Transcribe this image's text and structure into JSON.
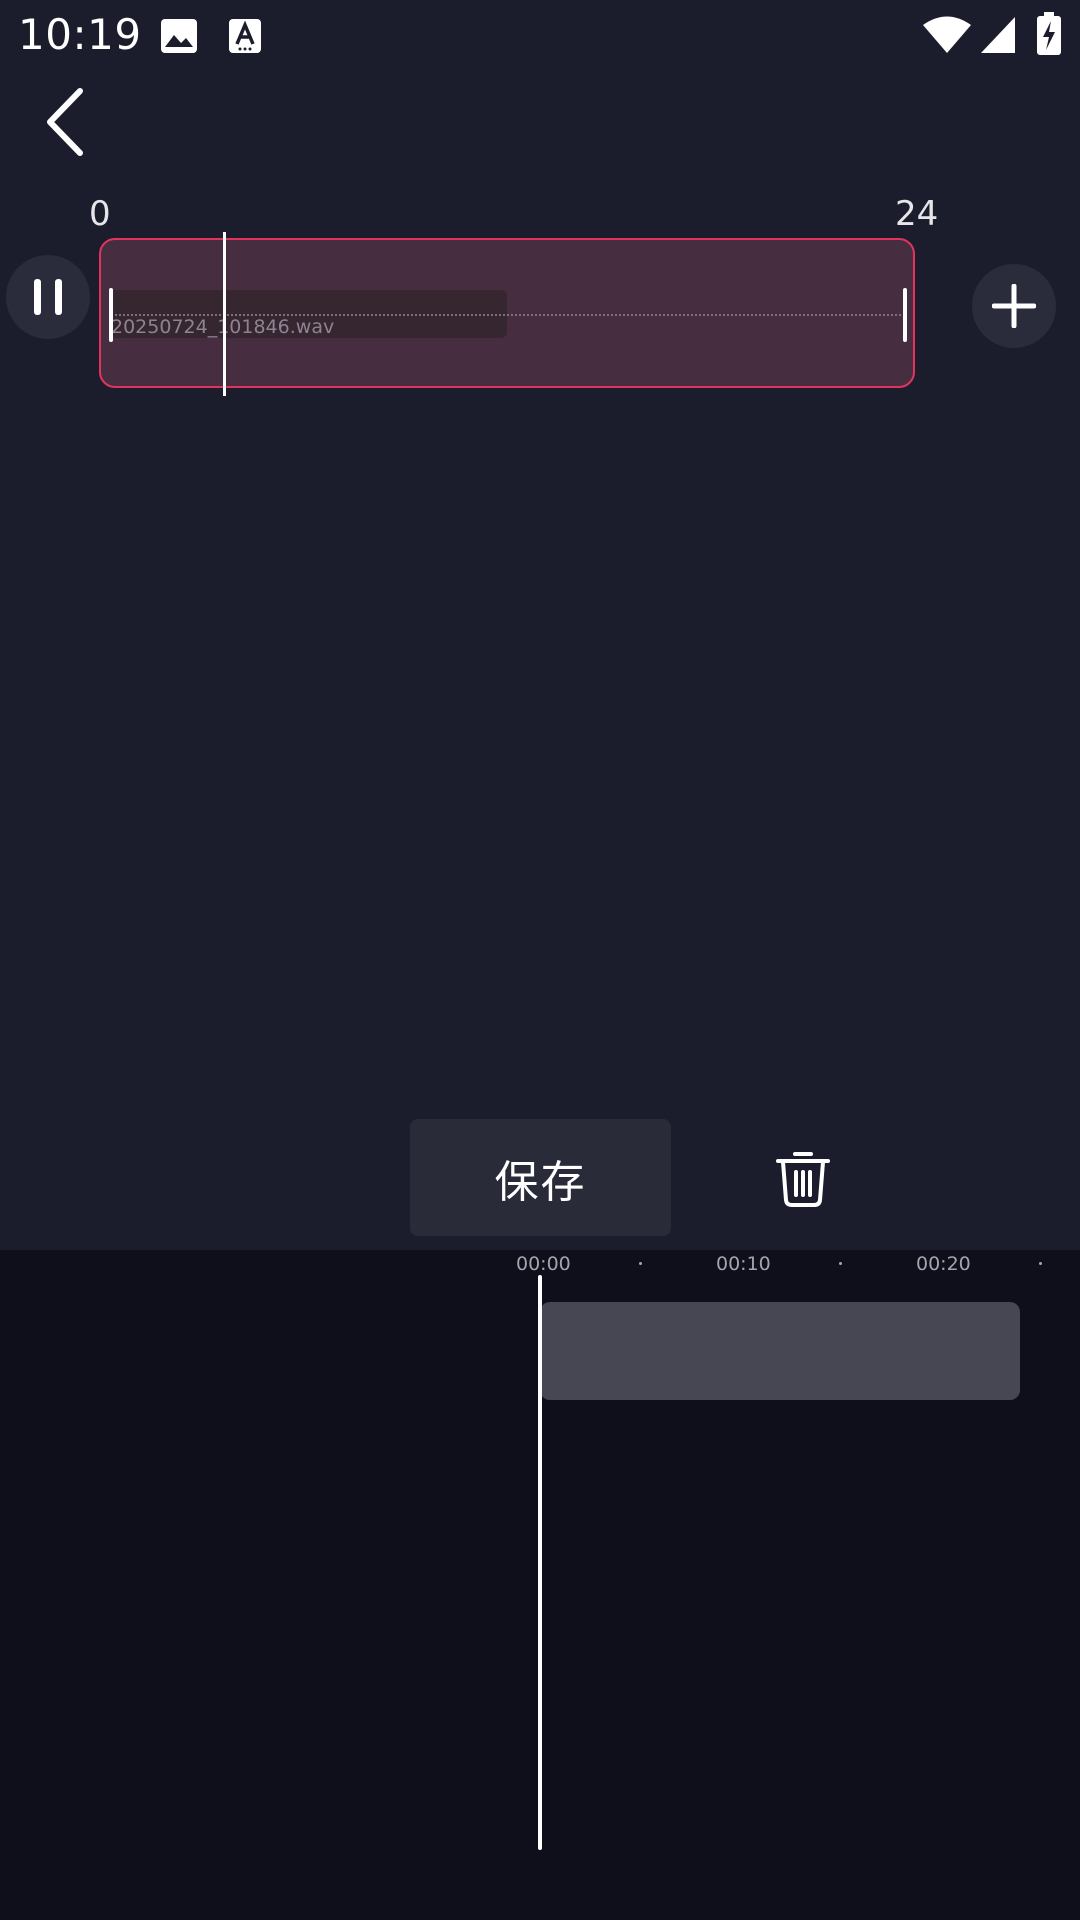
{
  "status_bar": {
    "time": "10:19"
  },
  "ruler": {
    "start_label": "0",
    "end_label": "24"
  },
  "clip": {
    "filename": "20250724_101846.wav",
    "playhead_fraction": 0.13
  },
  "actions": {
    "save_label": "保存"
  },
  "timeline": {
    "ticks": [
      "00:00",
      "00:10",
      "00:20"
    ]
  },
  "colors": {
    "background": "#1c1d2c",
    "accent": "#e0345e",
    "clip_fill": "#472d40",
    "timeline_bg": "#0e0f1a",
    "timeline_clip": "#474753"
  },
  "icons": {
    "back": "chevron-left-icon",
    "pause": "pause-icon",
    "add": "plus-icon",
    "delete": "trash-icon",
    "status": [
      "image-icon",
      "text-a-icon",
      "wifi-icon",
      "cellular-icon",
      "battery-charging-icon"
    ]
  }
}
